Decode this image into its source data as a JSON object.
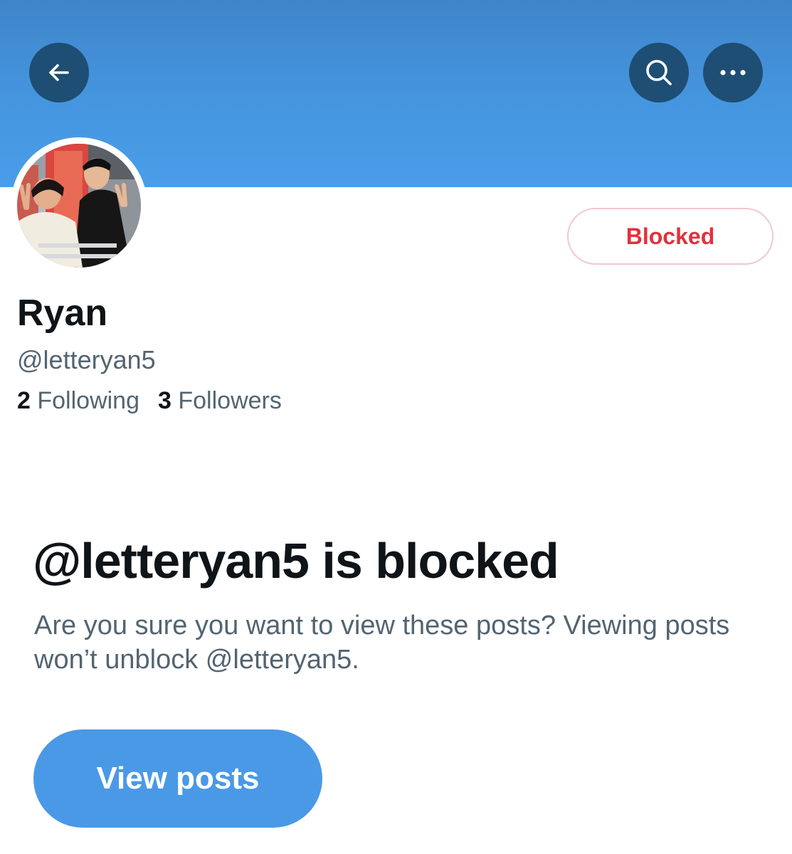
{
  "header": {
    "banner_color": "#4596e0",
    "back_icon": "arrow-left-icon",
    "search_icon": "search-icon",
    "more_icon": "more-horizontal-icon"
  },
  "profile": {
    "avatar_icon": "profile-photo",
    "display_name": "Ryan",
    "handle": "@letteryan5",
    "block_button_label": "Blocked",
    "following_count": "2",
    "following_label": "Following",
    "followers_count": "3",
    "followers_label": "Followers"
  },
  "blocked_notice": {
    "title": "@letteryan5 is blocked",
    "description": "Are you sure you want to view these posts? Viewing posts won’t unblock @letteryan5.",
    "view_button_label": "View posts",
    "accent_color": "#4a99e6",
    "danger_color": "#e0323c"
  }
}
